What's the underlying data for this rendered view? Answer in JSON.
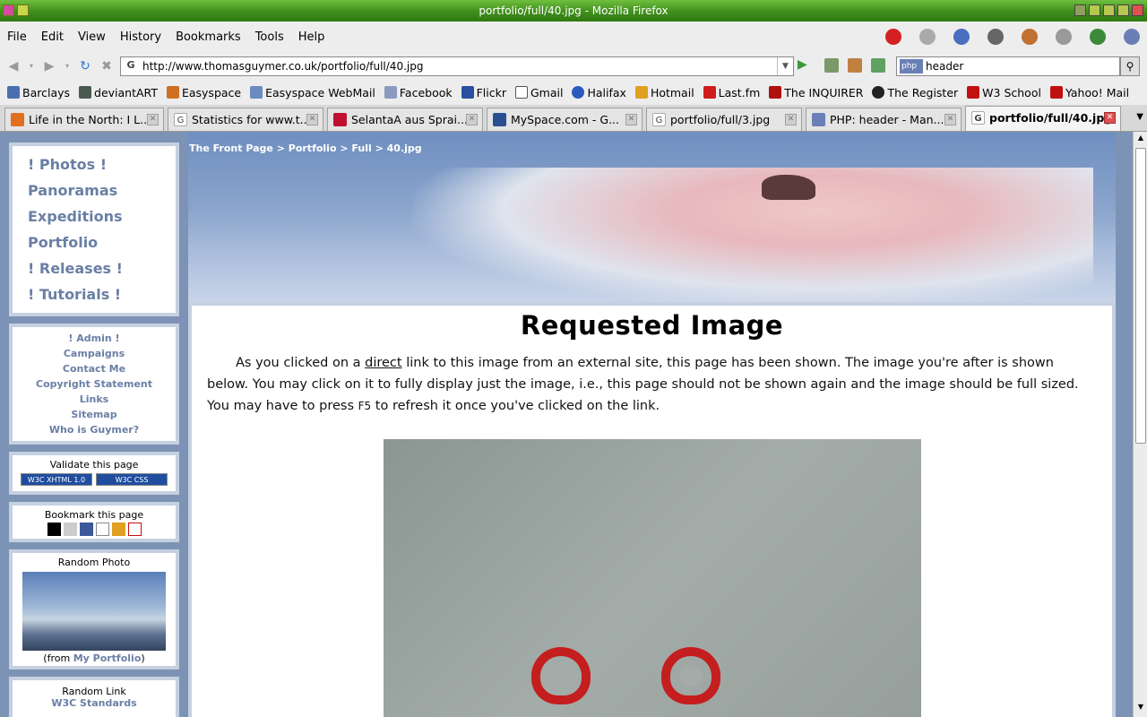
{
  "window": {
    "title": "portfolio/full/40.jpg - Mozilla Firefox"
  },
  "menu": [
    "File",
    "Edit",
    "View",
    "History",
    "Bookmarks",
    "Tools",
    "Help"
  ],
  "nav": {
    "url": "http://www.thomasguymer.co.uk/portfolio/full/40.jpg",
    "search_value": "header",
    "search_engine": "php"
  },
  "bookmarks": [
    "Barclays",
    "deviantART",
    "Easyspace",
    "Easyspace WebMail",
    "Facebook",
    "Flickr",
    "Gmail",
    "Halifax",
    "Hotmail",
    "Last.fm",
    "The INQUIRER",
    "The Register",
    "W3 School",
    "Yahoo! Mail"
  ],
  "tabs": [
    {
      "label": "Life in the North: I L...",
      "icon": "blogger-icon"
    },
    {
      "label": "Statistics for www.t...",
      "icon": "google-icon"
    },
    {
      "label": "SelantaA aus Sprai...",
      "icon": "red-icon"
    },
    {
      "label": "MySpace.com - G...",
      "icon": "myspace-icon"
    },
    {
      "label": "portfolio/full/3.jpg",
      "icon": "google-icon"
    },
    {
      "label": "PHP: header - Man...",
      "icon": "php-icon"
    },
    {
      "label": "portfolio/full/40.jpg",
      "icon": "google-icon",
      "active": true
    }
  ],
  "sidebar": {
    "nav": [
      "! Photos !",
      "Panoramas",
      "Expeditions",
      "Portfolio",
      "! Releases !",
      "! Tutorials !"
    ],
    "links": [
      "! Admin !",
      "Campaigns",
      "Contact Me",
      "Copyright Statement",
      "Links",
      "Sitemap",
      "Who is Guymer?"
    ],
    "validate_title": "Validate this page",
    "validate_badges": [
      "W3C XHTML 1.0",
      "W3C CSS"
    ],
    "bookmark_title": "Bookmark this page",
    "random_photo_title": "Random Photo",
    "random_photo_from": "(from",
    "random_photo_link": "My Portfolio",
    "random_photo_close": ")",
    "random_link_title": "Random Link",
    "random_link": "W3C Standards"
  },
  "breadcrumb": {
    "home": "The Front Page",
    "portfolio": "Portfolio",
    "full": "Full",
    "current": "40.jpg",
    "sep": " > "
  },
  "content": {
    "heading": "Requested Image",
    "p_before": "As you clicked on a ",
    "p_link": "direct",
    "p_mid": " link to this image from an external site, this page has been shown. The image you're after is shown below. You may click on it to fully display just the image, i.e., this page should not be shown again and the image should be full sized. You may have to press ",
    "p_key": "F5",
    "p_after": " to refresh it once you've clicked on the link."
  }
}
